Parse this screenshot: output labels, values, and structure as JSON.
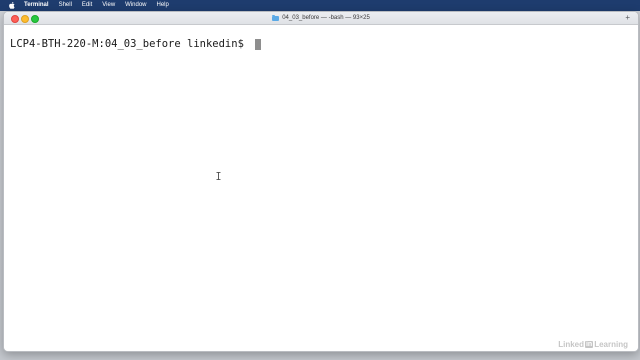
{
  "menubar": {
    "apple_icon": "apple-logo-icon",
    "items": [
      "Terminal",
      "Shell",
      "Edit",
      "View",
      "Window",
      "Help"
    ]
  },
  "window": {
    "title": "04_03_before — -bash — 93×25",
    "folder_icon": "folder-icon",
    "add_button": "+"
  },
  "terminal": {
    "prompt": "LCP4-BTH-220-M:04_03_before linkedin$ "
  },
  "watermark": {
    "text_before": "Linked",
    "text_in": "in",
    "text_after": " Learning"
  },
  "colors": {
    "menubar": "#1e3c6e",
    "close": "#fe5f57",
    "minimize": "#febc2e",
    "maximize": "#28c840",
    "cursor": "#8e8e8e"
  }
}
